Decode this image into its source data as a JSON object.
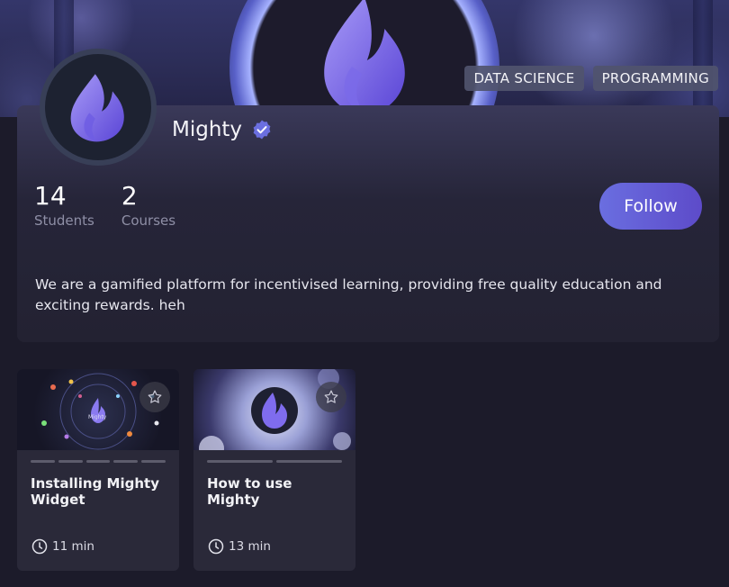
{
  "banner": {
    "tags": [
      "DATA SCIENCE",
      "PROGRAMMING"
    ]
  },
  "profile": {
    "name": "Mighty",
    "verified": true,
    "stats": [
      {
        "value": "14",
        "label": "Students"
      },
      {
        "value": "2",
        "label": "Courses"
      }
    ],
    "follow_label": "Follow",
    "bio": "We are a gamified platform for incentivised learning, providing free quality education and exciting rewards. heh"
  },
  "courses": [
    {
      "title": "Installing Mighty Widget",
      "duration": "11 min",
      "thumb_text": "Mighty"
    },
    {
      "title": "How to use Mighty",
      "duration": "13 min"
    }
  ],
  "colors": {
    "accent": "#6a6ee0",
    "accent_dark": "#5d4bc9",
    "background": "#1c1b2a",
    "card": "#2a2939",
    "flame_light": "#9b8cf5",
    "flame_dark": "#5a45d6",
    "verified": "#6b6fe0"
  },
  "icons": {
    "verified": "verified-badge-icon",
    "favorite": "star-outline-icon",
    "duration": "clock-icon",
    "logo": "flame-logo-icon"
  }
}
